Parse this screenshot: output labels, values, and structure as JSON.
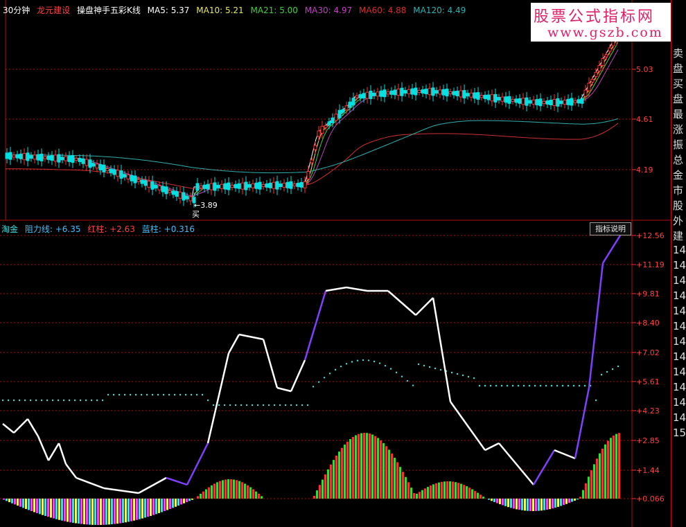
{
  "header": {
    "period": "30分钟",
    "stock": "龙元建设",
    "indicator": "操盘神手五彩K线",
    "ma": [
      {
        "label": "MA5: 5.37",
        "color": "#ffffff"
      },
      {
        "label": "MA10: 5.21",
        "color": "#e8e860"
      },
      {
        "label": "MA21: 5.00",
        "color": "#40d040"
      },
      {
        "label": "MA30: 4.97",
        "color": "#c040c0"
      },
      {
        "label": "MA60: 4.88",
        "color": "#d03030"
      },
      {
        "label": "MA120: 4.49",
        "color": "#30b0b0"
      }
    ]
  },
  "watermark": {
    "line1": "股票公式指标网",
    "line2": "www.gszb.com"
  },
  "price_axis": [
    "5.03",
    "4.61",
    "4.19"
  ],
  "buy_marker": {
    "price": "3.89",
    "label": "买"
  },
  "indicator_header": {
    "name": "淘金",
    "items": [
      {
        "label": "阻力线: +6.35",
        "color": "#40c0ff"
      },
      {
        "label": "红柱: +2.63",
        "color": "#ff4040"
      },
      {
        "label": "蓝柱: +0.316",
        "color": "#40c0ff"
      }
    ]
  },
  "indicator_button": "指标说明",
  "indicator_axis": [
    "+12.56",
    "+11.19",
    "+9.81",
    "+8.40",
    "+7.02",
    "+5.61",
    "+4.23",
    "+2.85",
    "+1.44",
    "+0.066"
  ],
  "side_panel": [
    "卖",
    "盘",
    "买",
    "盘",
    "最",
    "涨",
    "振",
    "总",
    "金",
    "市",
    "股",
    "外",
    "建",
    "14",
    "14",
    "14",
    "14",
    "14",
    "14",
    "14",
    "14",
    "14",
    "14",
    "14",
    "14",
    "15"
  ],
  "colors": {
    "grid": "#b01010",
    "axis": "#ff3030",
    "bull": "#ff3030",
    "bear": "#00e0e0",
    "cyan": "#40e0e0"
  }
}
